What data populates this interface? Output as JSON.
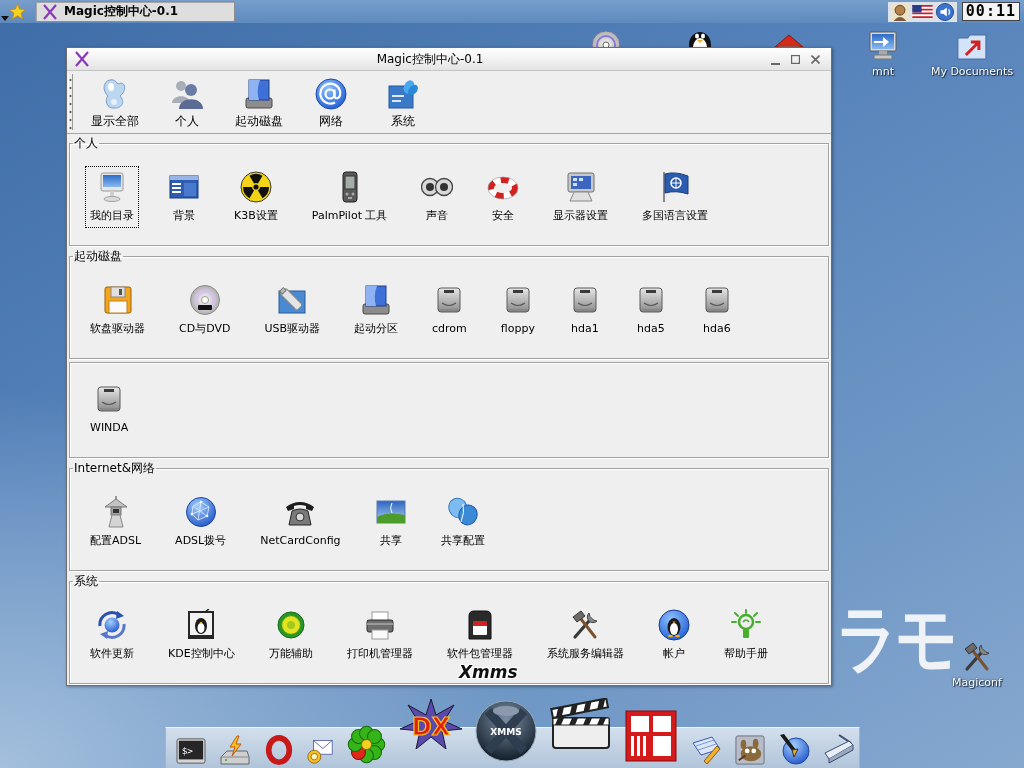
{
  "taskbar": {
    "tasks": [
      {
        "title": "Magic控制中心-0.1",
        "selected": true
      }
    ],
    "clock": "00:11"
  },
  "desktop": {
    "wallpaper_text": "ラモ",
    "icons": [
      {
        "kind": "cd"
      },
      {
        "kind": "tux"
      },
      {
        "kind": "house"
      },
      {
        "kind": "netmonitor",
        "label": "mnt"
      },
      {
        "kind": "folder",
        "label": "My Documents"
      },
      {
        "kind": "tools",
        "label": "Magiconf"
      }
    ]
  },
  "window": {
    "title": "Magic控制中心-0.1",
    "toolbar": [
      {
        "kind": "crystal",
        "label": "显示全部"
      },
      {
        "kind": "people",
        "label": "个人"
      },
      {
        "kind": "bootdisk",
        "label": "起动磁盘"
      },
      {
        "kind": "at",
        "label": "网络"
      },
      {
        "kind": "logobox",
        "label": "系统"
      }
    ],
    "sections": [
      {
        "title": "个人",
        "items": [
          {
            "kind": "imac",
            "label": "我的目录",
            "selected": true
          },
          {
            "kind": "window",
            "label": "背景",
            "selected": false
          },
          {
            "kind": "radiation",
            "label": "K3B设置",
            "selected": false
          },
          {
            "kind": "pda",
            "label": "PalmPilot 工具",
            "selected": false
          },
          {
            "kind": "speakers",
            "label": "声音",
            "selected": false
          },
          {
            "kind": "lifebuoy",
            "label": "安全",
            "selected": false
          },
          {
            "kind": "display",
            "label": "显示器设置",
            "selected": false
          },
          {
            "kind": "flag",
            "label": "多国语言设置",
            "selected": false
          }
        ]
      },
      {
        "title": "起动磁盘",
        "items": [
          {
            "kind": "floppy",
            "label": "软盘驱动器",
            "selected": false
          },
          {
            "kind": "dvd",
            "label": "CD与DVD",
            "selected": false
          },
          {
            "kind": "usb",
            "label": "USB驱动器",
            "selected": false
          },
          {
            "kind": "bootdisk",
            "label": "起动分区",
            "selected": false
          },
          {
            "kind": "hdd",
            "label": "cdrom",
            "selected": false
          },
          {
            "kind": "hdd",
            "label": "floppy",
            "selected": false
          },
          {
            "kind": "hdd",
            "label": "hda1",
            "selected": false
          },
          {
            "kind": "hdd",
            "label": "hda5",
            "selected": false
          },
          {
            "kind": "hdd",
            "label": "hda6",
            "selected": false
          }
        ]
      },
      {
        "items": [
          {
            "kind": "hdd",
            "label": "WINDA",
            "selected": false
          }
        ]
      },
      {
        "title": "Internet&网络",
        "items": [
          {
            "kind": "lantern",
            "label": "配置ADSL",
            "selected": false
          },
          {
            "kind": "globe",
            "label": "ADSL拨号",
            "selected": false
          },
          {
            "kind": "telephone",
            "label": "NetCardConfig",
            "selected": false
          },
          {
            "kind": "landscape",
            "label": "共享",
            "selected": false
          },
          {
            "kind": "butterfly",
            "label": "共享配置",
            "selected": false
          }
        ]
      },
      {
        "title": "系统",
        "items": [
          {
            "kind": "refresh",
            "label": "软件更新",
            "selected": false
          },
          {
            "kind": "kdepanel",
            "label": "KDE控制中心",
            "selected": false
          },
          {
            "kind": "flower",
            "label": "万能辅助",
            "selected": false
          },
          {
            "kind": "printer",
            "label": "打印机管理器",
            "selected": false
          },
          {
            "kind": "cartridge",
            "label": "软件包管理器",
            "selected": false
          },
          {
            "kind": "tools",
            "label": "系统服务编辑器",
            "selected": false
          },
          {
            "kind": "penguin",
            "label": "帐户",
            "selected": false
          },
          {
            "kind": "lightbulb",
            "label": "帮助手册",
            "selected": false
          }
        ]
      }
    ]
  },
  "dock": {
    "tooltip": "Xmms",
    "items": [
      {
        "kind": "terminal",
        "text": "$>"
      },
      {
        "kind": "flashdrive"
      },
      {
        "kind": "ring"
      },
      {
        "kind": "mail"
      },
      {
        "kind": "icq"
      },
      {
        "kind": "starlogo",
        "text": "DX"
      },
      {
        "kind": "sphere",
        "text": "XMMS"
      },
      {
        "kind": "clapper"
      },
      {
        "kind": "tilelogo"
      },
      {
        "kind": "notepad"
      },
      {
        "kind": "mascot"
      },
      {
        "kind": "penglobe"
      },
      {
        "kind": "scanner"
      }
    ]
  }
}
